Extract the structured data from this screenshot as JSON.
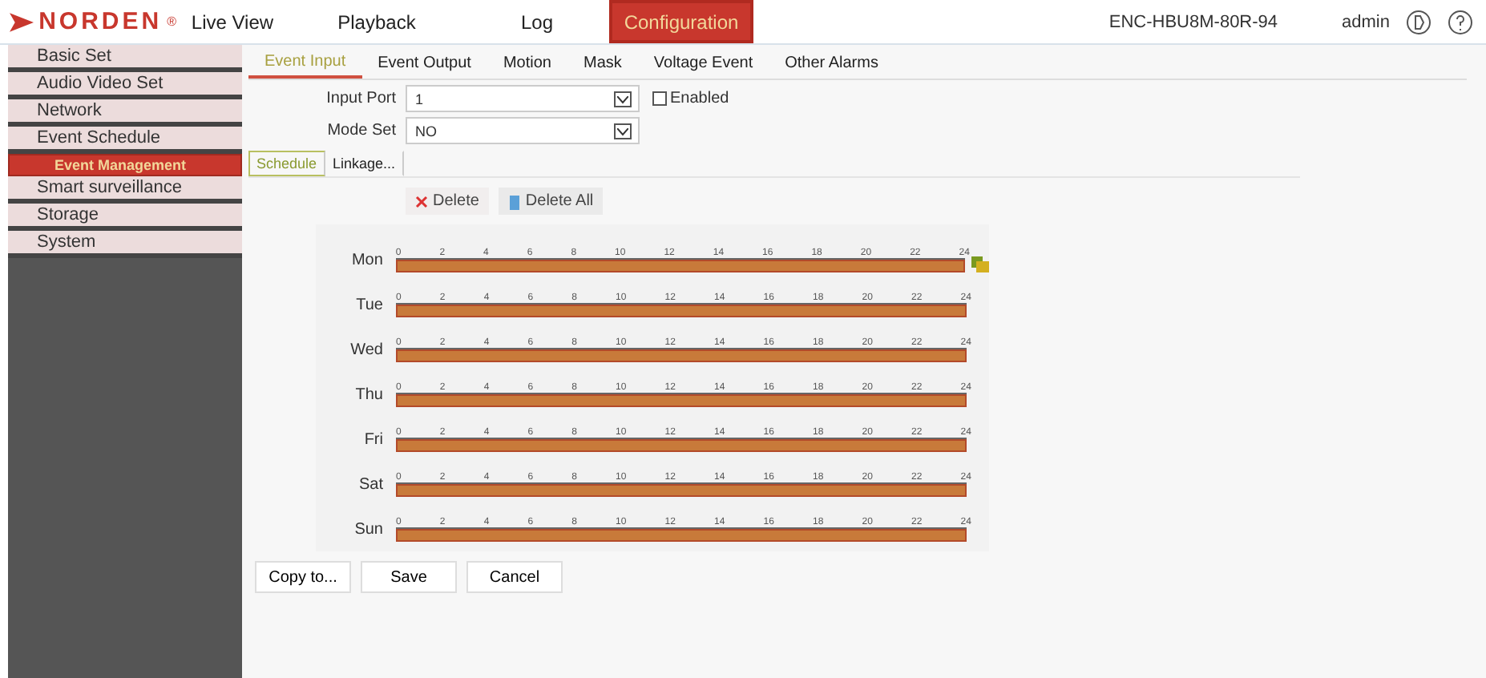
{
  "header": {
    "logo": "NORDEN",
    "logo_mark": "®",
    "nav": [
      {
        "label": "Live View",
        "selected": false
      },
      {
        "label": "Playback",
        "selected": false
      },
      {
        "label": "Log",
        "selected": false
      },
      {
        "label": "Configuration",
        "selected": true
      }
    ],
    "device": "ENC-HBU8M-80R-94",
    "user": "admin"
  },
  "sidebar": {
    "items": [
      {
        "label": "Basic Set",
        "selected": false
      },
      {
        "label": "Audio Video Set",
        "selected": false
      },
      {
        "label": "Network",
        "selected": false
      },
      {
        "label": "Event Schedule",
        "selected": false,
        "children": [
          {
            "label": "Event Management",
            "selected": true
          }
        ]
      },
      {
        "label": "Smart surveillance",
        "selected": false
      },
      {
        "label": "Storage",
        "selected": false
      },
      {
        "label": "System",
        "selected": false
      }
    ]
  },
  "tabs": [
    {
      "label": "Event Input",
      "selected": true
    },
    {
      "label": "Event Output",
      "selected": false
    },
    {
      "label": "Motion",
      "selected": false
    },
    {
      "label": "Mask",
      "selected": false
    },
    {
      "label": "Voltage Event",
      "selected": false
    },
    {
      "label": "Other Alarms",
      "selected": false
    }
  ],
  "form": {
    "input_port": {
      "label": "Input Port",
      "value": "1"
    },
    "enabled": {
      "label": "Enabled",
      "checked": false
    },
    "mode_set": {
      "label": "Mode Set",
      "value": "NO"
    }
  },
  "subtabs": [
    {
      "label": "Schedule",
      "selected": true
    },
    {
      "label": "Linkage...",
      "selected": false
    }
  ],
  "actions": {
    "delete": "Delete",
    "delete_all": "Delete All"
  },
  "schedule": [
    {
      "day": "Mon",
      "level": 1,
      "ticks": [
        "0",
        "2",
        "4",
        "6",
        "8",
        "10",
        "12",
        "14",
        "16",
        "18",
        "20",
        "22",
        "24"
      ]
    },
    {
      "day": "Tue",
      "level": 1,
      "ticks": [
        "0",
        "2",
        "4",
        "6",
        "8",
        "10",
        "12",
        "14",
        "16",
        "18",
        "20",
        "22",
        "24"
      ]
    },
    {
      "day": "Wed",
      "level": 1,
      "ticks": [
        "0",
        "2",
        "4",
        "6",
        "8",
        "10",
        "12",
        "14",
        "16",
        "18",
        "20",
        "22",
        "24"
      ]
    },
    {
      "day": "Thu",
      "level": 1,
      "ticks": [
        "0",
        "2",
        "4",
        "6",
        "8",
        "10",
        "12",
        "14",
        "16",
        "18",
        "20",
        "22",
        "24"
      ]
    },
    {
      "day": "Fri",
      "level": 1,
      "ticks": [
        "0",
        "2",
        "4",
        "6",
        "8",
        "10",
        "12",
        "14",
        "16",
        "18",
        "20",
        "22",
        "24"
      ]
    },
    {
      "day": "Sat",
      "level": 1,
      "ticks": [
        "0",
        "2",
        "4",
        "6",
        "8",
        "10",
        "12",
        "14",
        "16",
        "18",
        "20",
        "22",
        "24"
      ]
    },
    {
      "day": "Sun",
      "level": 1,
      "ticks": [
        "0",
        "2",
        "4",
        "6",
        "8",
        "10",
        "12",
        "14",
        "16",
        "18",
        "20",
        "22",
        "24"
      ]
    }
  ],
  "buttons": [
    "Copy to...",
    "Save",
    "Cancel"
  ]
}
